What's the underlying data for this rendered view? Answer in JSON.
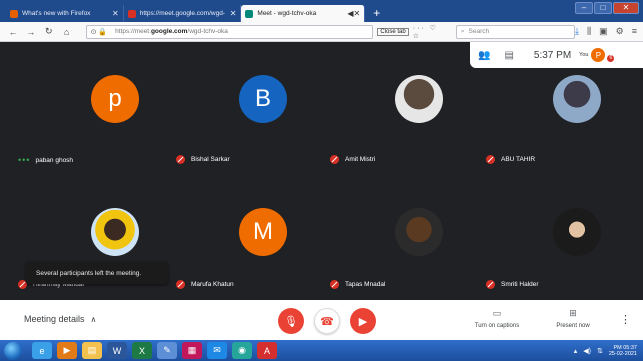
{
  "browser": {
    "tabs": [
      {
        "title": "What's new with Firefox",
        "icon_color": "#e66000",
        "active": false
      },
      {
        "title": "https://meet.google.com/wgd-",
        "icon_color": "#d93025",
        "active": false
      },
      {
        "title": "Meet - wgd-tchv-oka",
        "icon_color": "#00897b",
        "active": true
      }
    ],
    "url_prefix": "https://meet.",
    "url_host": "google.com",
    "url_path": "/wgd-tchv-oka",
    "close_tab_label": "Close tab",
    "search_placeholder": "Search"
  },
  "meet_top": {
    "time": "5:37 PM",
    "self_label": "You",
    "self_initial": "P",
    "badge_count": "6"
  },
  "participants": [
    {
      "name": "paban ghosh",
      "initial": "p",
      "color": "#ef6c00",
      "muted": false,
      "speaking": true
    },
    {
      "name": "Bishal Sarkar",
      "initial": "B",
      "color": "#1565c0",
      "muted": true
    },
    {
      "name": "Amit Mistri",
      "initial": "",
      "photo": "ph1",
      "muted": true
    },
    {
      "name": "ABU TAHIR",
      "initial": "",
      "photo": "ph2",
      "muted": true
    },
    {
      "name": "Hiranmay Mandal",
      "initial": "",
      "photo": "ph3",
      "muted": true
    },
    {
      "name": "Marufa Khatun",
      "initial": "M",
      "color": "#ef6c00",
      "muted": true
    },
    {
      "name": "Tapas Mnadal",
      "initial": "",
      "photo": "ph4",
      "muted": true
    },
    {
      "name": "Smriti Halder",
      "initial": "",
      "photo": "ph5",
      "muted": true
    }
  ],
  "toast": "Several participants left the meeting.",
  "bottom": {
    "meeting_details": "Meeting details",
    "captions_label": "Turn on captions",
    "present_label": "Present now"
  },
  "taskbar": {
    "time": "PM 05:37",
    "date": "25-02-2021",
    "apps": [
      {
        "name": "ie-icon",
        "glyph": "e",
        "color": "#3aa0e8"
      },
      {
        "name": "media-icon",
        "glyph": "▶",
        "color": "#e07b18"
      },
      {
        "name": "explorer-icon",
        "glyph": "▤",
        "color": "#f2c14e"
      },
      {
        "name": "word-icon",
        "glyph": "W",
        "color": "#2b579a"
      },
      {
        "name": "excel-icon",
        "glyph": "X",
        "color": "#1d7a44"
      },
      {
        "name": "paint-icon",
        "glyph": "✎",
        "color": "#5d8fd6"
      },
      {
        "name": "app-icon",
        "glyph": "▦",
        "color": "#c2185b"
      },
      {
        "name": "mail-icon",
        "glyph": "✉",
        "color": "#1e88e5"
      },
      {
        "name": "search-icon",
        "glyph": "◉",
        "color": "#26a69a"
      },
      {
        "name": "pdf-icon",
        "glyph": "A",
        "color": "#d32f2f"
      }
    ]
  }
}
